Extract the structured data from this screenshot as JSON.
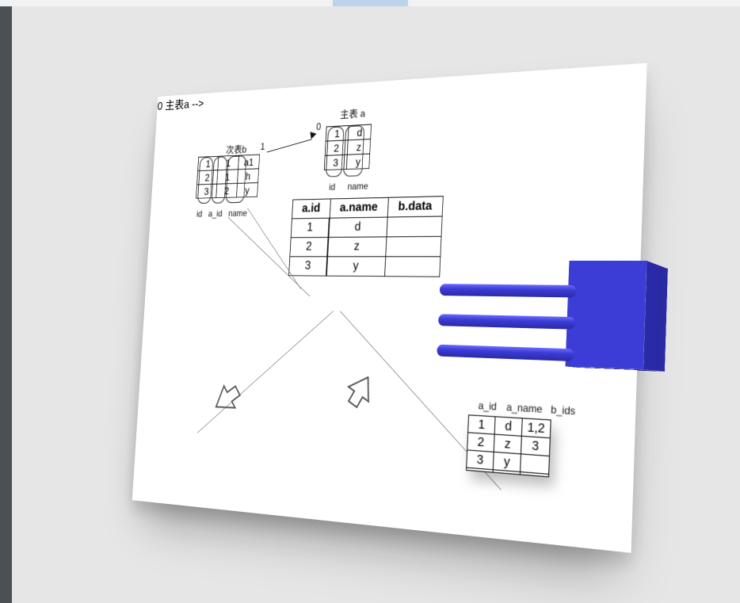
{
  "labels": {
    "mainTable": "主表 a",
    "subTable": "次表b",
    "zero": "0",
    "one": "1",
    "id": "id",
    "name": "name",
    "id_col": "id",
    "aid_col": "a_id",
    "name_col": "name"
  },
  "tableA": {
    "rows": [
      {
        "id": "1",
        "name": "d"
      },
      {
        "id": "2",
        "name": "z"
      },
      {
        "id": "3",
        "name": "y"
      }
    ]
  },
  "tableB": {
    "rows": [
      {
        "id": "1",
        "a_id": "1",
        "name": "a1"
      },
      {
        "id": "2",
        "a_id": "1",
        "name": "h"
      },
      {
        "id": "3",
        "a_id": "2",
        "name": "y"
      }
    ]
  },
  "centerHeaders": {
    "c1": "a.id",
    "c2": "a.name",
    "c3": "b.data"
  },
  "centerRows": [
    {
      "aid": "1",
      "aname": "d",
      "bdata": ""
    },
    {
      "aid": "2",
      "aname": "z",
      "bdata": ""
    },
    {
      "aid": "3",
      "aname": "y",
      "bdata": ""
    }
  ],
  "resultHeaders": {
    "c1": "a_id",
    "c2": "a_name",
    "c3": "b_ids"
  },
  "resultRows": [
    {
      "aid": "1",
      "aname": "d",
      "bids": "1,2"
    },
    {
      "aid": "2",
      "aname": "z",
      "bids": "3"
    },
    {
      "aid": "3",
      "aname": "y",
      "bids": ""
    },
    {
      "aid": "",
      "aname": "",
      "bids": ""
    }
  ]
}
